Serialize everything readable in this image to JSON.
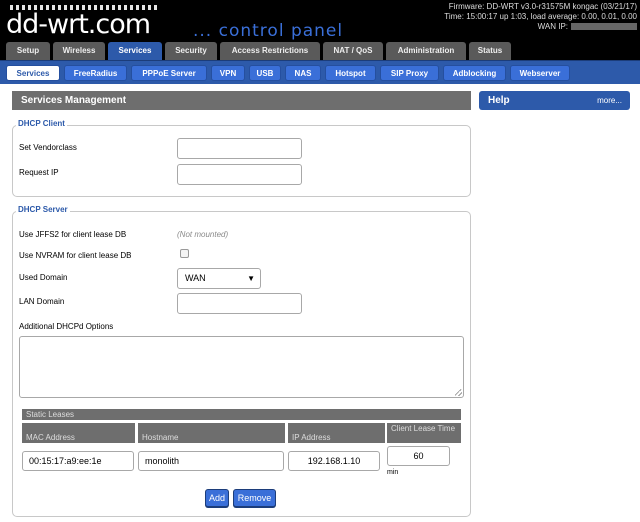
{
  "header": {
    "logo_main": "dd-wrt",
    "logo_suffix": ".com",
    "control_panel": "... control panel",
    "firmware": "Firmware: DD-WRT v3.0-r31575M kongac (03/21/17)",
    "time": "Time: 15:00:17 up 1:03, load average: 0.00, 0.01, 0.00",
    "wan_ip_label": "WAN IP:"
  },
  "main_tabs": [
    "Setup",
    "Wireless",
    "Services",
    "Security",
    "Access Restrictions",
    "NAT / QoS",
    "Administration",
    "Status"
  ],
  "sub_tabs": [
    "Services",
    "FreeRadius",
    "PPPoE Server",
    "VPN",
    "USB",
    "NAS",
    "Hotspot",
    "SIP Proxy",
    "Adblocking",
    "Webserver"
  ],
  "page_title": "Services Management",
  "help": {
    "title": "Help",
    "more": "more..."
  },
  "dhcp_client": {
    "legend": "DHCP Client",
    "vendorclass_label": "Set Vendorclass",
    "vendorclass_value": "",
    "request_ip_label": "Request IP",
    "request_ip_value": ""
  },
  "dhcp_server": {
    "legend": "DHCP Server",
    "jffs2_label": "Use JFFS2 for client lease DB",
    "jffs2_status": "(Not mounted)",
    "nvram_label": "Use NVRAM for client lease DB",
    "nvram_checked": false,
    "used_domain_label": "Used Domain",
    "used_domain_value": "WAN",
    "lan_domain_label": "LAN Domain",
    "lan_domain_value": "",
    "additional_label": "Additional DHCPd Options"
  },
  "static_leases": {
    "title": "Static Leases",
    "columns": [
      "MAC Address",
      "Hostname",
      "IP Address",
      "Client Lease Time"
    ],
    "rows": [
      {
        "mac": "00:15:17:a9:ee:1e",
        "hostname": "monolith",
        "ip": "192.168.1.10",
        "lease": "60",
        "unit": "min"
      }
    ],
    "add_label": "Add",
    "remove_label": "Remove"
  }
}
